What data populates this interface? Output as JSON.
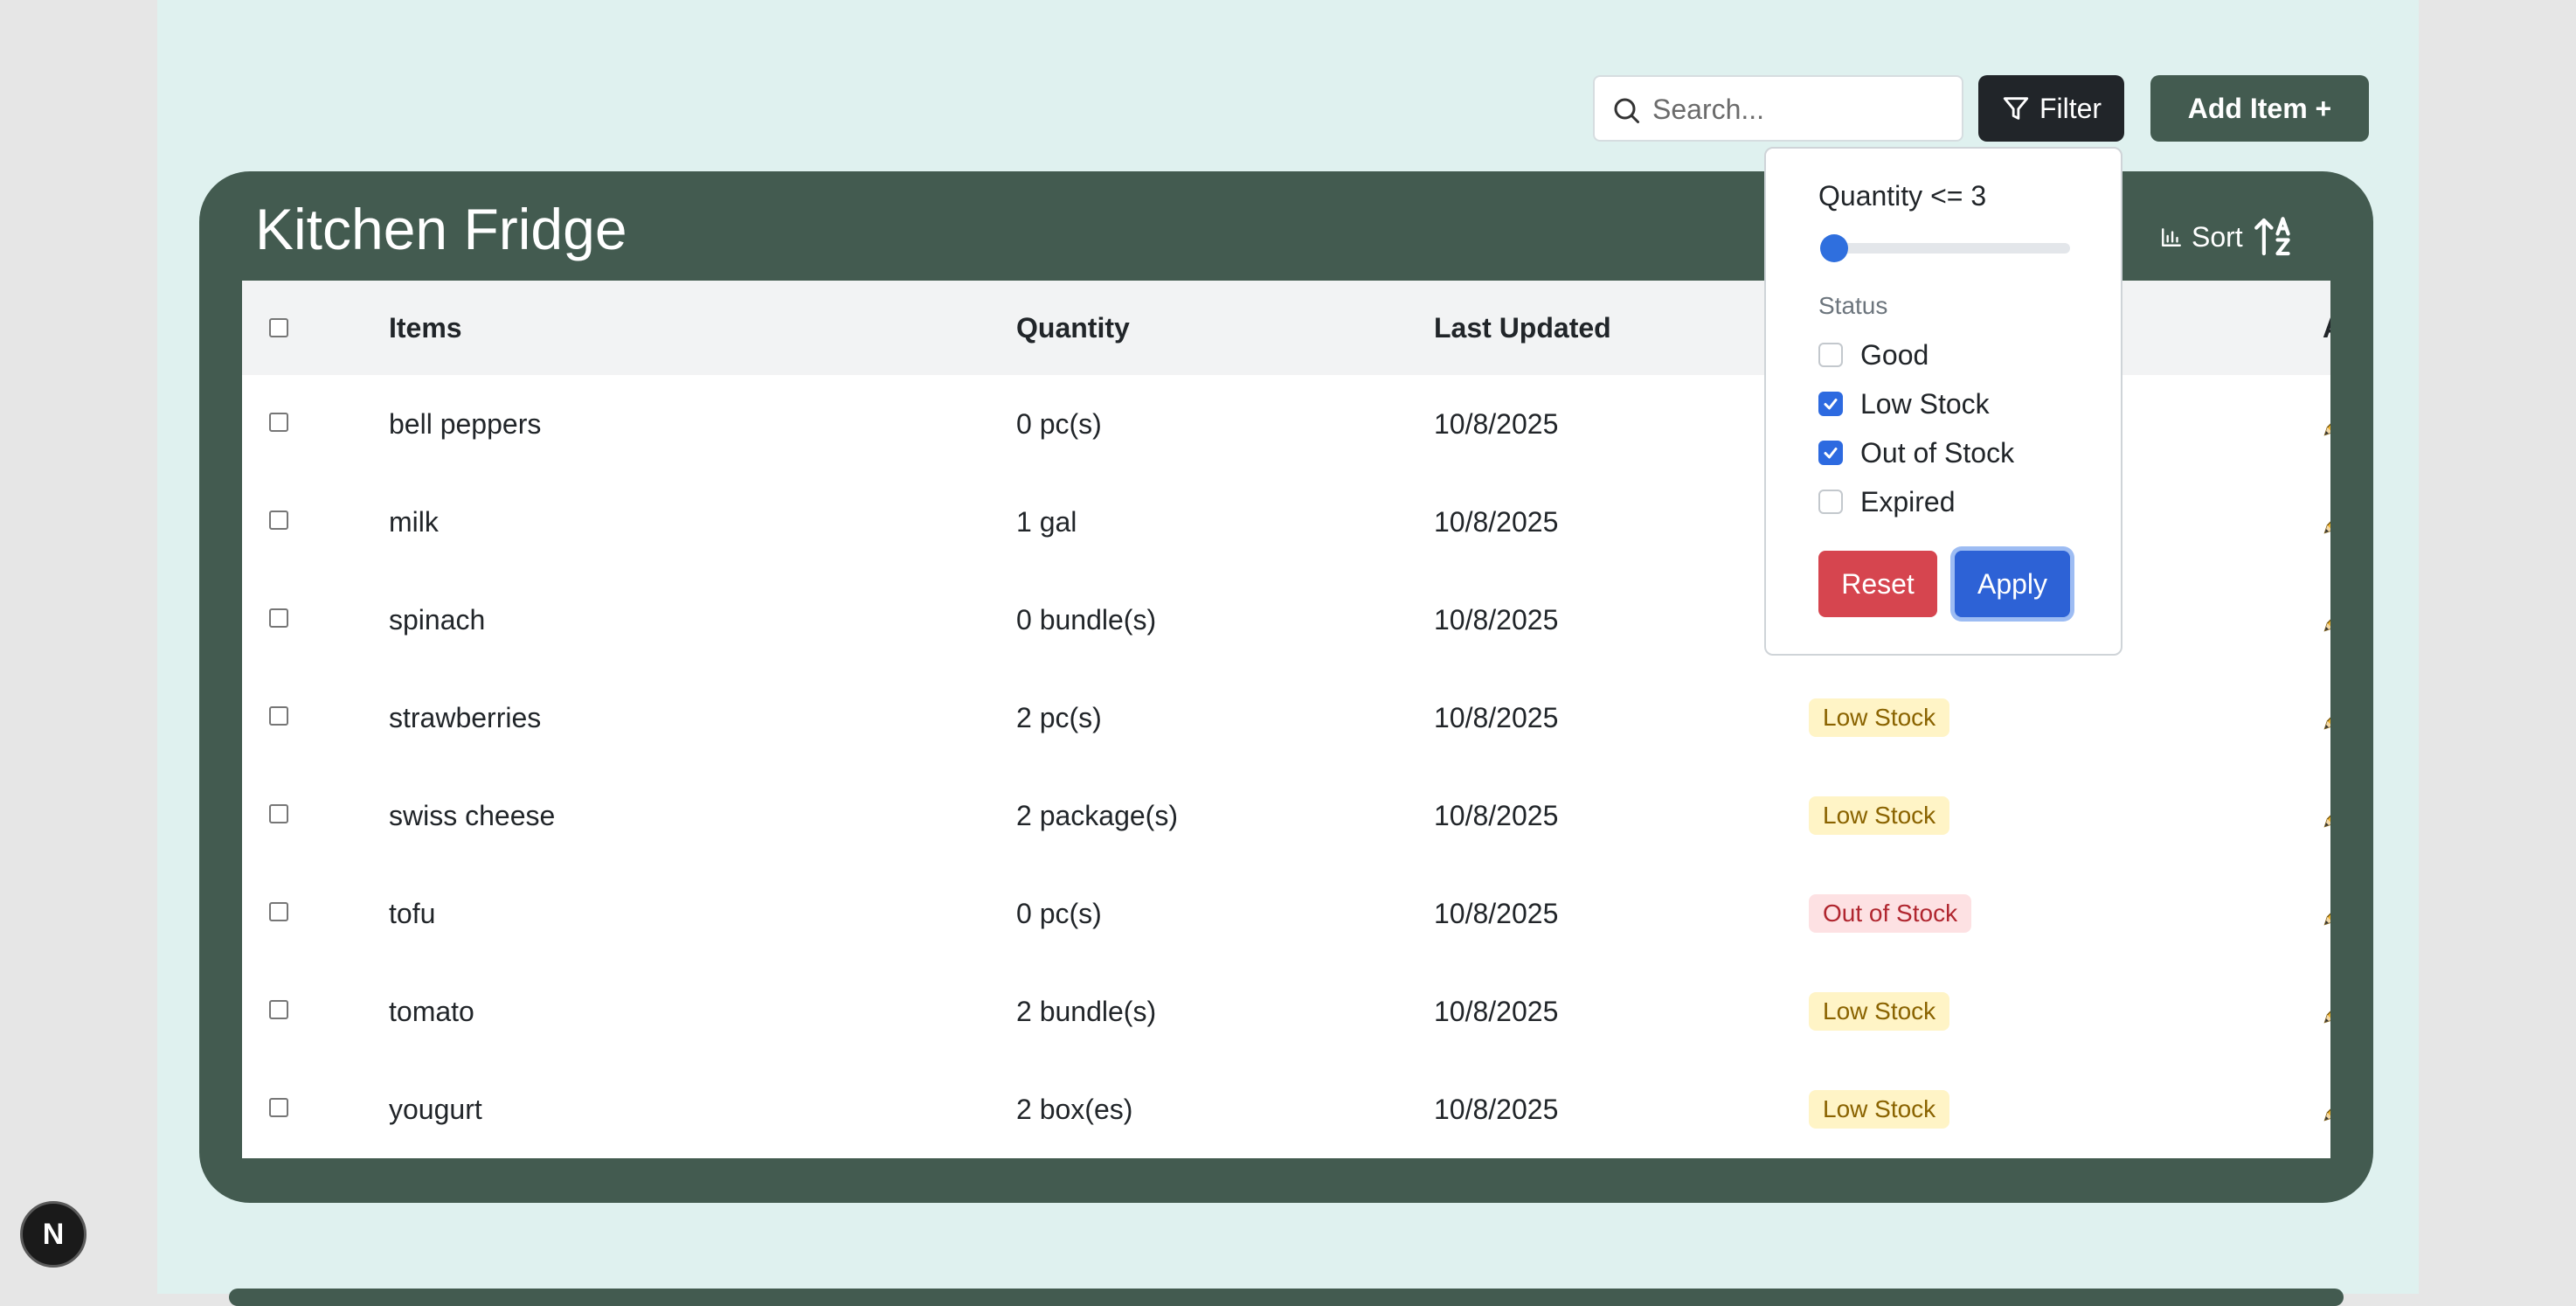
{
  "toolbar": {
    "search_placeholder": "Search...",
    "filter_label": "Filter",
    "add_label": "Add Item +"
  },
  "card": {
    "title": "Kitchen Fridge",
    "sort_label": "Sort"
  },
  "table": {
    "headers": {
      "items": "Items",
      "quantity": "Quantity",
      "last_updated": "Last Updated",
      "action": "Action"
    },
    "rows": [
      {
        "name": "bell peppers",
        "qty": "0 pc(s)",
        "updated": "10/8/2025",
        "status": ""
      },
      {
        "name": "milk",
        "qty": "1 gal",
        "updated": "10/8/2025",
        "status": ""
      },
      {
        "name": "spinach",
        "qty": "0 bundle(s)",
        "updated": "10/8/2025",
        "status": ""
      },
      {
        "name": "strawberries",
        "qty": "2 pc(s)",
        "updated": "10/8/2025",
        "status": "Low Stock"
      },
      {
        "name": "swiss cheese",
        "qty": "2 package(s)",
        "updated": "10/8/2025",
        "status": "Low Stock"
      },
      {
        "name": "tofu",
        "qty": "0 pc(s)",
        "updated": "10/8/2025",
        "status": "Out of Stock"
      },
      {
        "name": "tomato",
        "qty": "2 bundle(s)",
        "updated": "10/8/2025",
        "status": "Low Stock"
      },
      {
        "name": "yougurt",
        "qty": "2 box(es)",
        "updated": "10/8/2025",
        "status": "Low Stock"
      }
    ]
  },
  "filter_popover": {
    "quantity_label": "Quantity <= 3",
    "quantity_value": 3,
    "status_label": "Status",
    "options": [
      {
        "label": "Good",
        "checked": false
      },
      {
        "label": "Low Stock",
        "checked": true
      },
      {
        "label": "Out of Stock",
        "checked": true
      },
      {
        "label": "Expired",
        "checked": false
      }
    ],
    "reset_label": "Reset",
    "apply_label": "Apply"
  },
  "dev_badge": "N",
  "colors": {
    "page_bg": "#dff1ef",
    "card_bg": "#435b50",
    "filter_btn": "#212529",
    "reset": "#d6454f",
    "apply": "#2d62d6",
    "low_stock_bg": "#fff4c6",
    "out_of_stock_bg": "#fde1e3"
  }
}
